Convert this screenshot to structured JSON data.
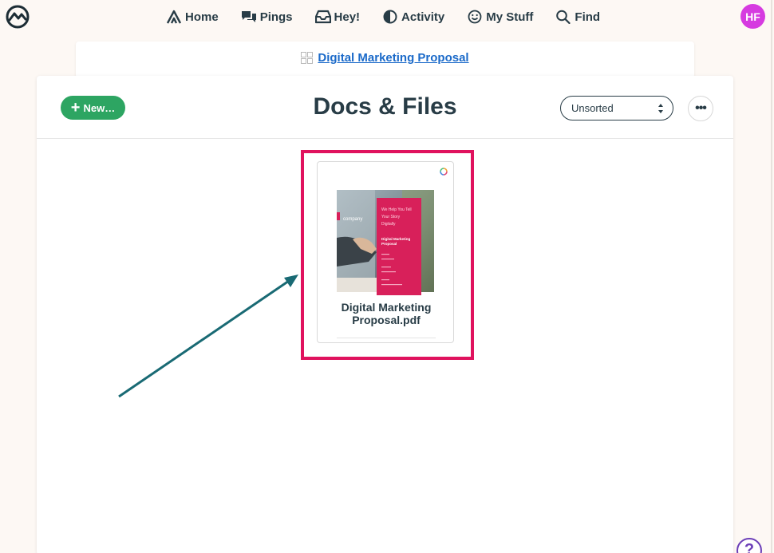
{
  "nav": {
    "items": [
      {
        "label": "Home",
        "icon": "home-icon"
      },
      {
        "label": "Pings",
        "icon": "pings-icon"
      },
      {
        "label": "Hey!",
        "icon": "inbox-icon"
      },
      {
        "label": "Activity",
        "icon": "activity-icon"
      },
      {
        "label": "My Stuff",
        "icon": "smiley-icon"
      },
      {
        "label": "Find",
        "icon": "search-icon"
      }
    ],
    "avatar_initials": "HF"
  },
  "breadcrumb": {
    "project": "Digital Marketing Proposal",
    "icon": "grid-icon"
  },
  "header": {
    "title": "Docs & Files",
    "new_button": "New…",
    "sort": {
      "selected": "Unsorted"
    },
    "more_button": "•••"
  },
  "file": {
    "name_line1": "Digital Marketing",
    "name_line2": "Proposal.pdf",
    "thumbnail": {
      "brand": "company",
      "tagline": [
        "We Help You Tell",
        "Your Story",
        "Digitally"
      ],
      "doc_title": [
        "Digital Marketing",
        "Proposal"
      ]
    }
  },
  "colors": {
    "accent_green": "#2da562",
    "highlight": "#e0125e",
    "link": "#1b6ac9",
    "avatar": "#d63be0",
    "arrow": "#196a74"
  },
  "help": {
    "label": "?"
  }
}
